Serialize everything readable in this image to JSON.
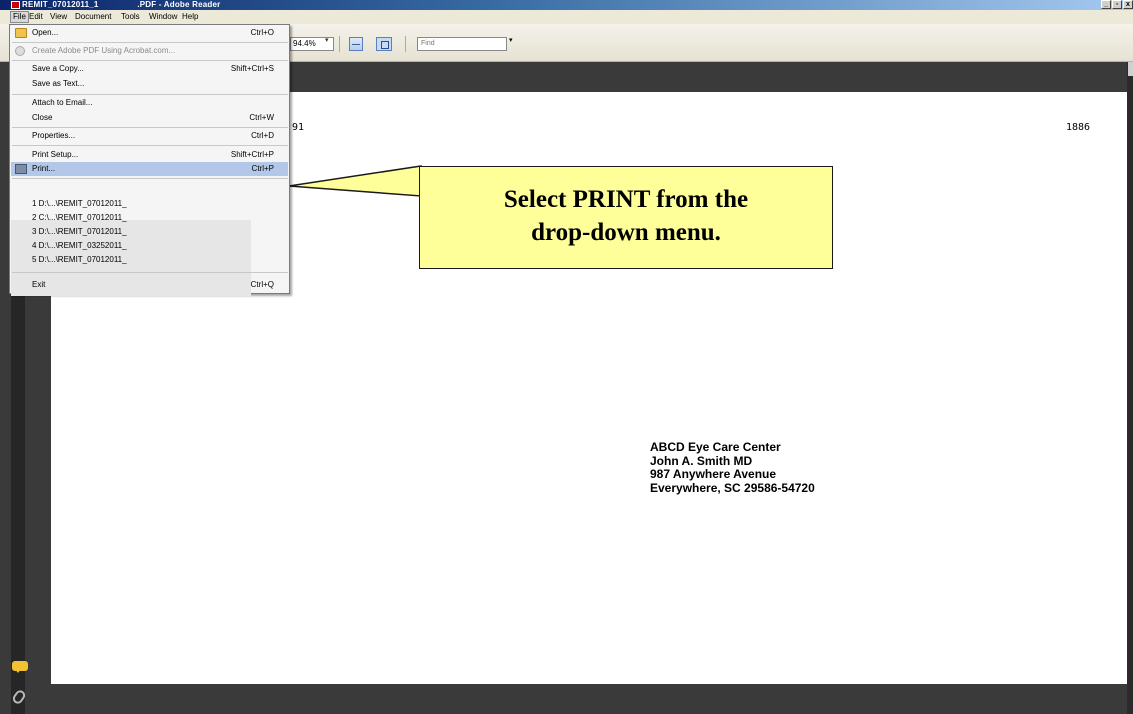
{
  "window": {
    "title": "REMIT_07012011_1                .PDF - Adobe Reader",
    "min_label": "_",
    "max_label": "▫",
    "close_label": "x"
  },
  "menubar": {
    "items": [
      "File",
      "Edit",
      "View",
      "Document",
      "Tools",
      "Window",
      "Help"
    ]
  },
  "toolbar": {
    "zoom_value": "94.4%",
    "find_placeholder": "Find"
  },
  "file_menu": {
    "open": {
      "label": "Open...",
      "shortcut": "Ctrl+O"
    },
    "create_pdf": {
      "label": "Create Adobe PDF Using Acrobat.com..."
    },
    "save_copy": {
      "label": "Save a Copy...",
      "shortcut": "Shift+Ctrl+S"
    },
    "save_text": {
      "label": "Save as Text..."
    },
    "attach_email": {
      "label": "Attach to Email..."
    },
    "close": {
      "label": "Close",
      "shortcut": "Ctrl+W"
    },
    "properties": {
      "label": "Properties...",
      "shortcut": "Ctrl+D"
    },
    "print_setup": {
      "label": "Print Setup...",
      "shortcut": "Shift+Ctrl+P"
    },
    "print": {
      "label": "Print...",
      "shortcut": "Ctrl+P"
    },
    "recent": [
      "1 D:\\...\\REMIT_07012011_",
      "2 C:\\...\\REMIT_07012011_",
      "3 D:\\...\\REMIT_07012011_",
      "4 D:\\...\\REMIT_03252011_",
      "5 D:\\...\\REMIT_07012011_"
    ],
    "exit": {
      "label": "Exit",
      "shortcut": "Ctrl+Q"
    }
  },
  "document": {
    "num_left": "91",
    "num_right": "1886",
    "address": [
      "ABCD Eye Care Center",
      "John A. Smith MD",
      "987 Anywhere Avenue",
      "Everywhere, SC 29586-54720"
    ]
  },
  "callout": {
    "line1": "Select PRINT from the",
    "line2": "drop-down menu.",
    "background": "#ffff99"
  }
}
